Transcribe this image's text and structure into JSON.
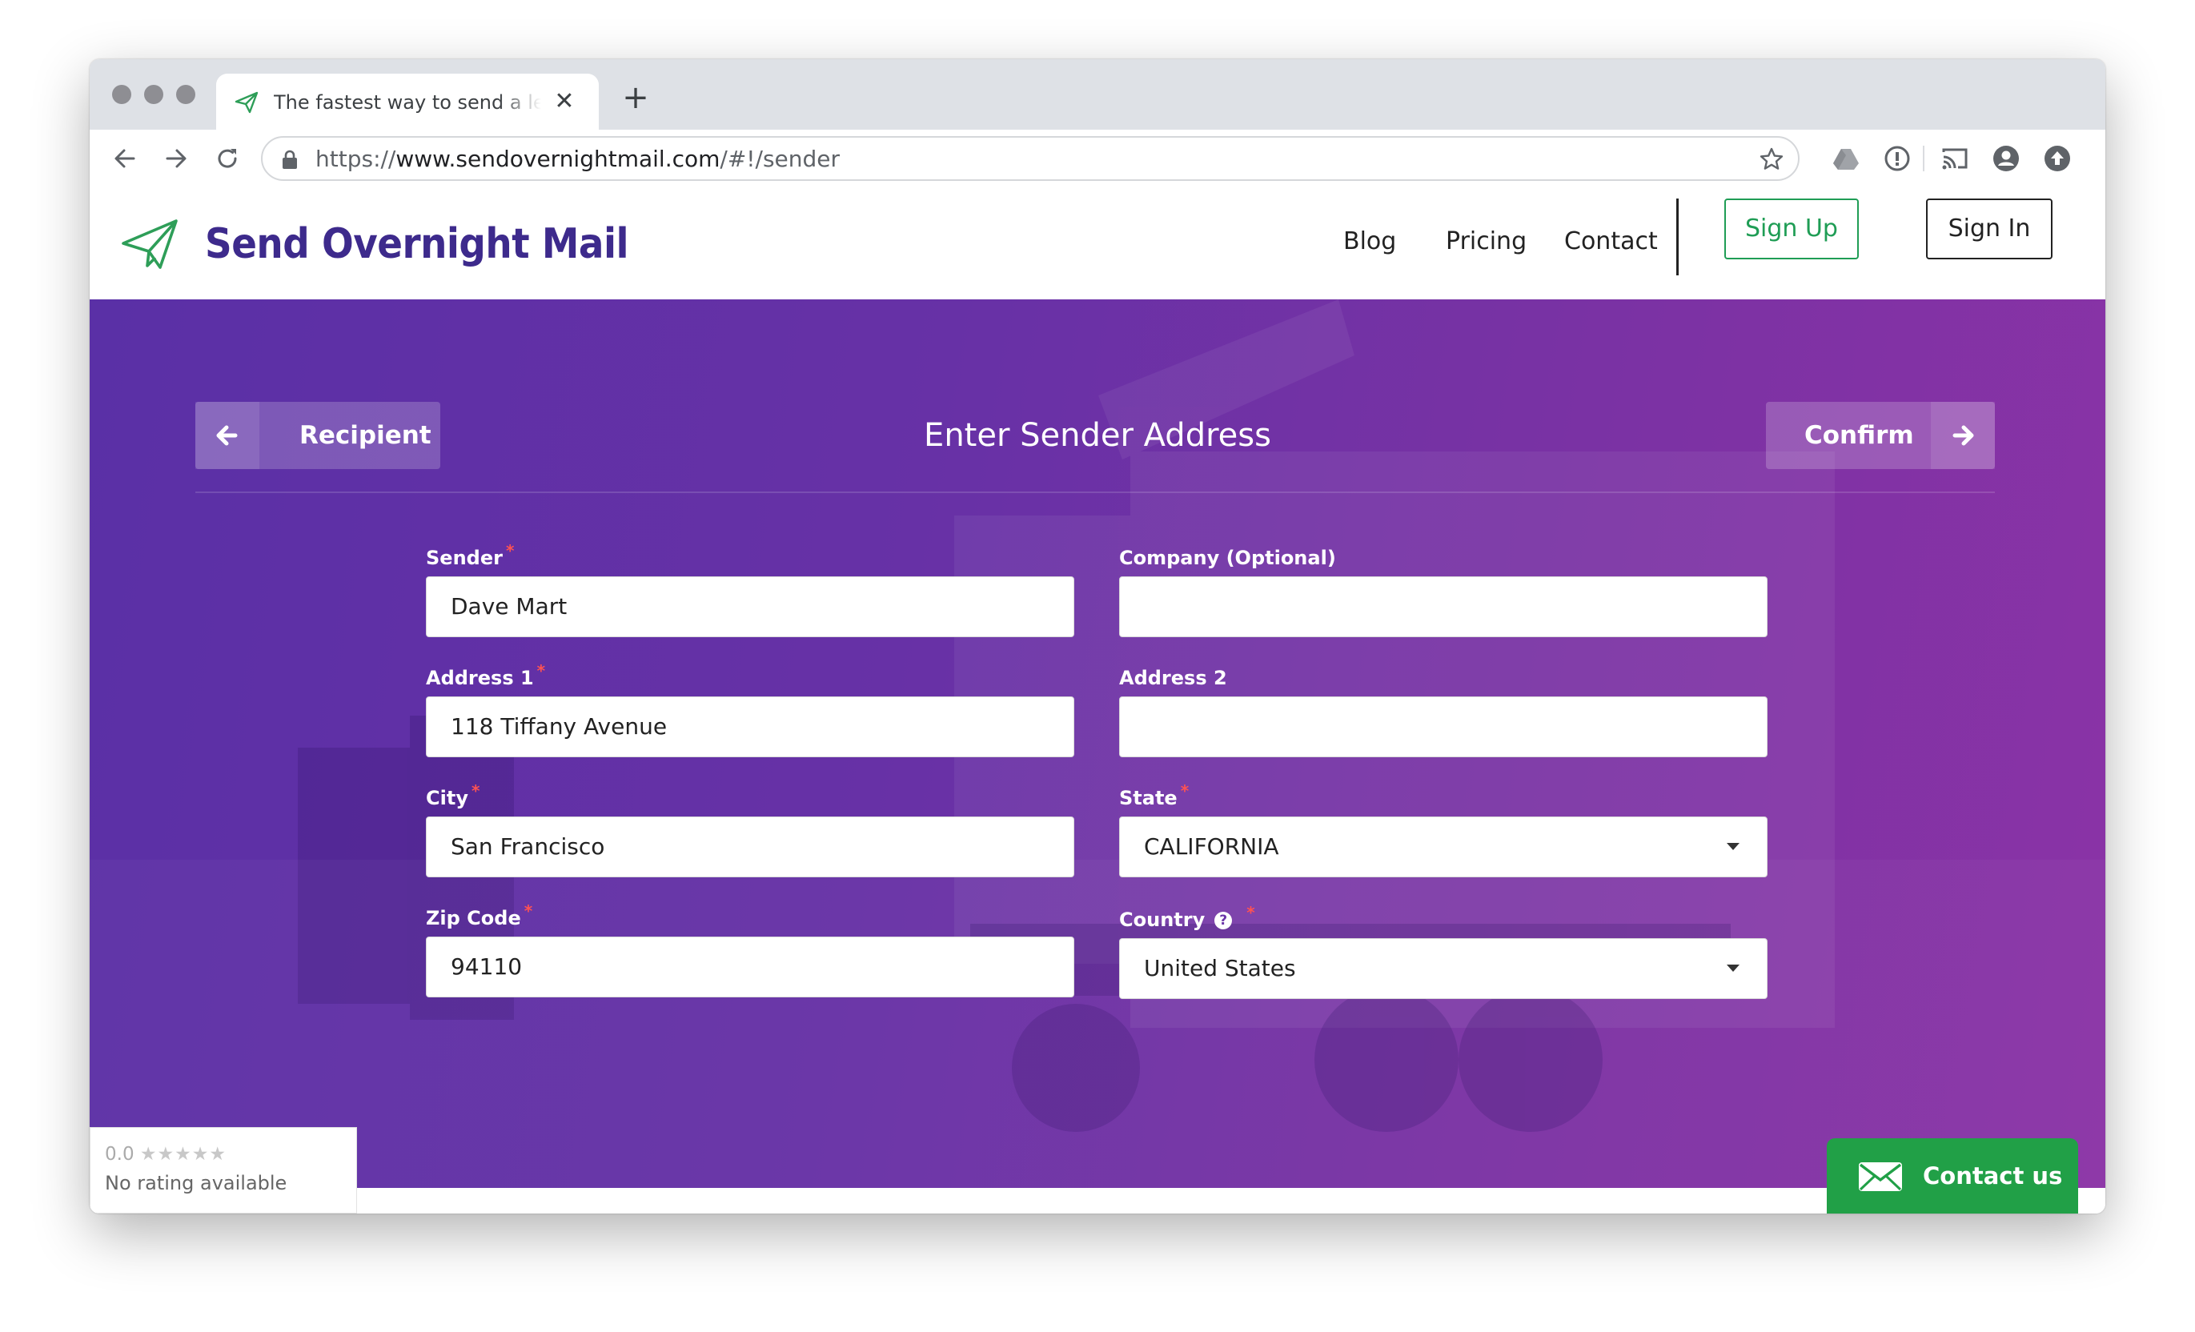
{
  "browser": {
    "tab_title": "The fastest way to send a letter online",
    "url_scheme": "https://",
    "url_domain": "www.sendovernightmail.com",
    "url_path": "/#!/sender"
  },
  "site": {
    "brand": "Send Overnight Mail",
    "nav": {
      "blog": "Blog",
      "pricing": "Pricing",
      "contact": "Contact",
      "sign_up": "Sign Up",
      "sign_in": "Sign In"
    }
  },
  "step": {
    "back_label": "Recipient",
    "title": "Enter Sender Address",
    "next_label": "Confirm"
  },
  "form": {
    "sender": {
      "label": "Sender",
      "required": "*",
      "value": "Dave Mart"
    },
    "company": {
      "label": "Company (Optional)",
      "value": ""
    },
    "address1": {
      "label": "Address 1",
      "required": "*",
      "value": "118 Tiffany Avenue"
    },
    "address2": {
      "label": "Address 2",
      "value": ""
    },
    "city": {
      "label": "City",
      "required": "*",
      "value": "San Francisco"
    },
    "state": {
      "label": "State",
      "required": "*",
      "value": "CALIFORNIA"
    },
    "zip": {
      "label": "Zip Code",
      "required": "*",
      "value": "94110"
    },
    "country": {
      "label": "Country",
      "help": "?",
      "required": "*",
      "value": "United States"
    }
  },
  "rating_widget": {
    "score": "0.0",
    "stars": "★★★★★",
    "text": "No rating available"
  },
  "contact_widget": {
    "label": "Contact us"
  },
  "colors": {
    "brand": "#3d2a8c",
    "accent_green": "#1f9d55",
    "hero_start": "#5a30a6",
    "hero_end": "#8b33a6",
    "contact_green": "#21a047"
  },
  "icons": [
    "paper-plane-icon",
    "close-icon",
    "plus-icon",
    "back-arrow-icon",
    "forward-arrow-icon",
    "reload-icon",
    "lock-icon",
    "star-icon",
    "drive-icon",
    "info-icon",
    "cast-icon",
    "account-icon",
    "upload-icon",
    "arrow-left-icon",
    "arrow-right-icon",
    "question-icon",
    "dropdown-caret-icon",
    "envelope-icon"
  ]
}
